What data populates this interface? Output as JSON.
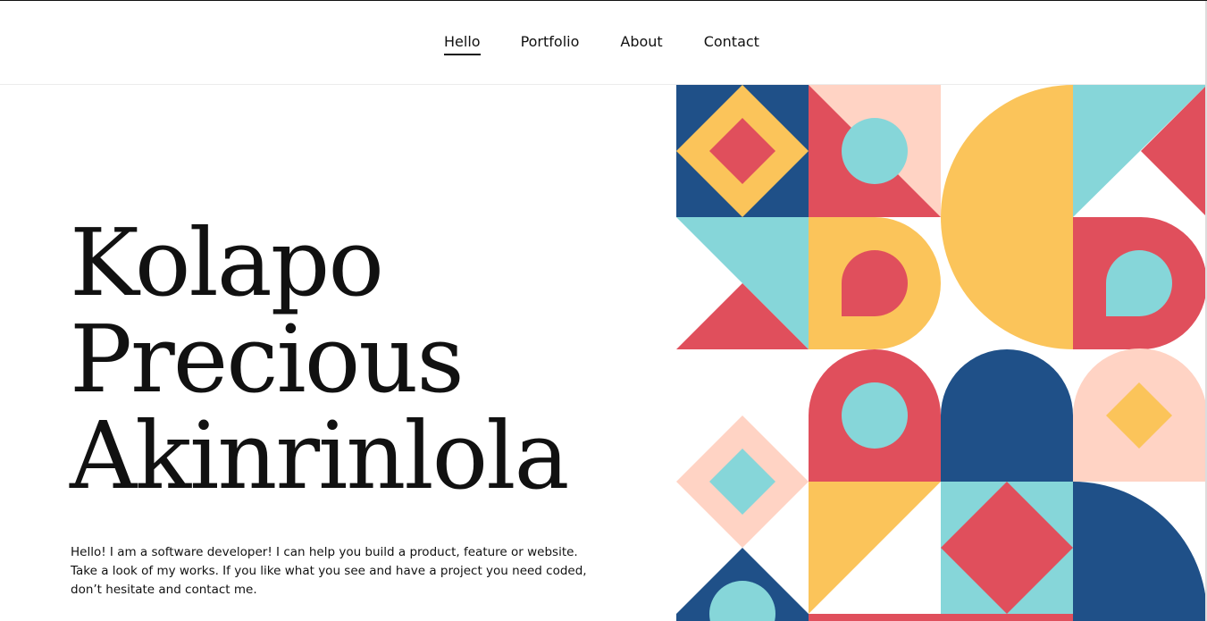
{
  "nav": {
    "items": [
      {
        "label": "Hello",
        "active": true
      },
      {
        "label": "Portfolio",
        "active": false
      },
      {
        "label": "About",
        "active": false
      },
      {
        "label": "Contact",
        "active": false
      }
    ]
  },
  "hero": {
    "name_lines": [
      "Kolapo",
      "Precious",
      "Akinrinlola"
    ],
    "intro_lines": [
      "Hello! I am a software developer! I can help you build a product, feature or website.",
      "Take a look of my works. If you like what you see and have a project you need coded,",
      "don’t hesitate and contact me."
    ]
  },
  "colors": {
    "navy": "#1f5088",
    "yellow": "#fbc45a",
    "red": "#e04f5c",
    "teal": "#86d6d9",
    "peach": "#ffd3c4",
    "white": "#ffffff"
  }
}
